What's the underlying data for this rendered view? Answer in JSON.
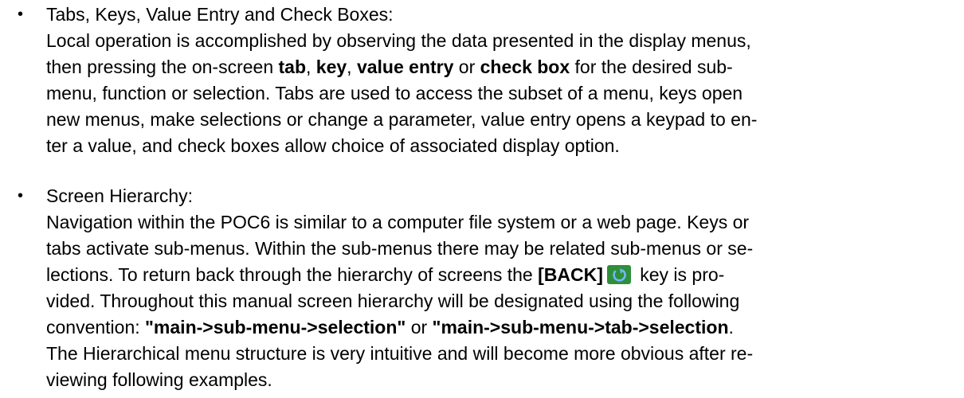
{
  "section1": {
    "bullet": "•",
    "heading": "Tabs, Keys, Value Entry and Check Boxes:",
    "l1": "Local operation is accomplished by observing the data presented in the display menus,",
    "l2_a": "then pressing the on-screen ",
    "l2_tab": "tab",
    "l2_sep1": ", ",
    "l2_key": "key",
    "l2_sep2": ", ",
    "l2_value": "value entry",
    "l2_or": " or ",
    "l2_check": "check box",
    "l2_b": " for the desired sub-",
    "l3": "menu, function or selection. Tabs are used to access the subset of a menu, keys open",
    "l4": "new menus, make selections or change a parameter, value entry opens a keypad to en-",
    "l5": "ter a value, and check boxes allow choice of associated display option."
  },
  "section2": {
    "bullet": "•",
    "heading": "Screen Hierarchy:",
    "l1": "Navigation within the POC6 is similar to a computer file system or a web page. Keys or",
    "l2": "tabs activate sub-menus. Within the sub-menus there may be related sub-menus or se-",
    "l3_a": "lections. To return back through the hierarchy of screens the ",
    "l3_back": "[BACK]",
    "l3_b": " key is pro-",
    "l4": "vided. Throughout this manual screen hierarchy will be designated using the following",
    "l5_a": "convention: ",
    "l5_conv1": "\"main->sub-menu->selection\"",
    "l5_or": " or ",
    "l5_conv2": "\"main->sub-menu->tab->selection",
    "l5_end": ".",
    "l6": "The Hierarchical menu structure is very intuitive and will become more obvious after re-",
    "l7": "viewing following examples."
  },
  "icons": {
    "back_icon": "back-arrow-icon",
    "back_icon_bg": "#2f8f3a",
    "back_icon_fg": "#6fb8ff"
  }
}
